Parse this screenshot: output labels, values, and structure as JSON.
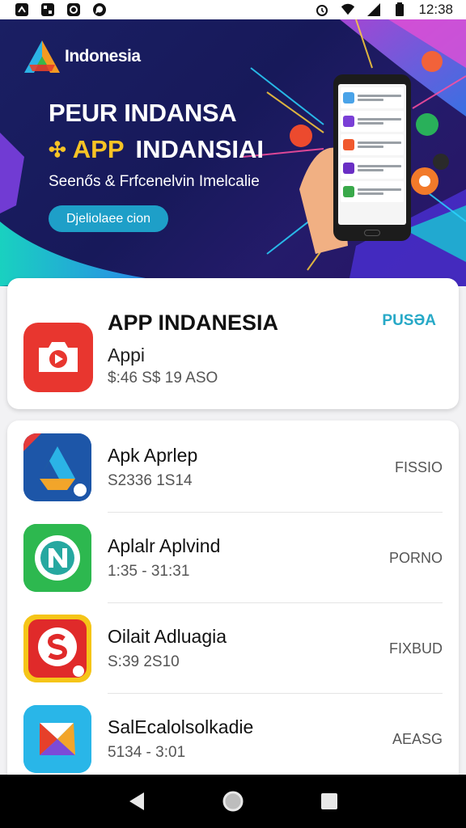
{
  "status_bar": {
    "time": "12:38",
    "left_icons": [
      "notification-icon",
      "gallery-icon",
      "sync-icon",
      "whatsapp-icon"
    ],
    "right_icons": [
      "alarm-icon",
      "wifi-icon",
      "signal-icon",
      "battery-icon"
    ]
  },
  "banner": {
    "brand": "Indonesia",
    "headline": "PEUR INDANSA",
    "headline2_app": "APP",
    "headline2_rest": "INDANSIAI",
    "tagline": "Seenős & Frfcenelvin Imelcalie",
    "button_label": "Djeliolaee cion"
  },
  "featured": {
    "title": "APP INDANESIA",
    "subtitle": "Appi",
    "meta": "$:46  S$  19 ASO",
    "action": "PUSƏA"
  },
  "apps": [
    {
      "name": "Apk Aprlep",
      "meta": "S2336 1S14",
      "action": "FISSIO"
    },
    {
      "name": "Aplalr Aplvind",
      "meta": "1:35 - 31:31",
      "action": "PORNO"
    },
    {
      "name": "Oilait Adluagia",
      "meta": "S:39  2S10",
      "action": "FIXBUD"
    },
    {
      "name": "SalEcalolsolkadie",
      "meta": "5134 - 3:01",
      "action": "AEASG"
    }
  ],
  "colors": {
    "banner_bg": "#1a1f63",
    "accent_yellow": "#f7c325",
    "accent_teal": "#27a9c7",
    "featured_icon": "#e8362f"
  },
  "navbar": {
    "icons": [
      "back-icon",
      "home-icon",
      "recents-icon"
    ]
  }
}
